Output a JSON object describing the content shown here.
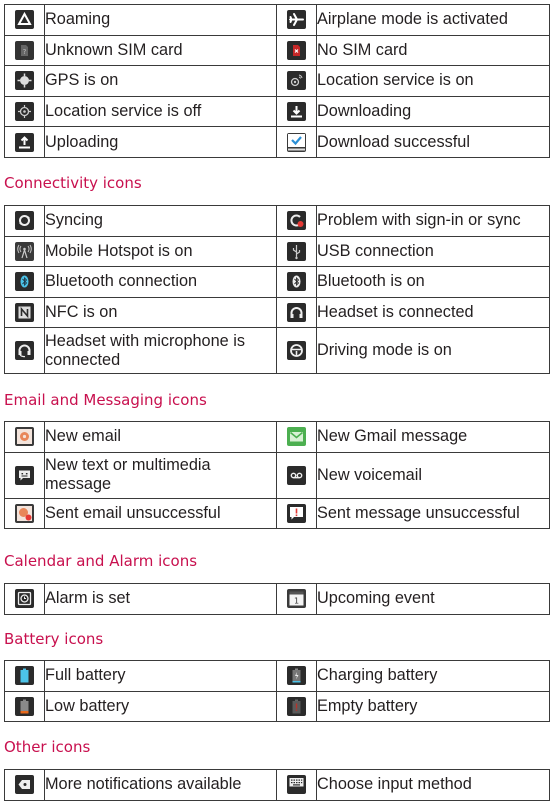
{
  "sections": {
    "status": {
      "rows": [
        {
          "left": {
            "icon": "roaming-icon",
            "label": "Roaming"
          },
          "right": {
            "icon": "airplane-icon",
            "label": "Airplane mode is activated"
          }
        },
        {
          "left": {
            "icon": "unknown-sim-icon",
            "label": "Unknown SIM card"
          },
          "right": {
            "icon": "no-sim-icon",
            "label": "No SIM card"
          }
        },
        {
          "left": {
            "icon": "gps-on-icon",
            "label": "GPS is on"
          },
          "right": {
            "icon": "location-on-icon",
            "label": "Location service is on"
          }
        },
        {
          "left": {
            "icon": "location-off-icon",
            "label": "Location service is off"
          },
          "right": {
            "icon": "download-icon",
            "label": "Downloading"
          }
        },
        {
          "left": {
            "icon": "upload-icon",
            "label": "Uploading"
          },
          "right": {
            "icon": "download-success-icon",
            "label": "Download successful"
          }
        }
      ]
    },
    "connectivity": {
      "title": "Connectivity icons",
      "rows": [
        {
          "left": {
            "icon": "sync-icon",
            "label": "Syncing"
          },
          "right": {
            "icon": "sync-problem-icon",
            "label": "Problem with sign-in or sync"
          }
        },
        {
          "left": {
            "icon": "hotspot-icon",
            "label": "Mobile Hotspot is on"
          },
          "right": {
            "icon": "usb-icon",
            "label": "USB connection"
          }
        },
        {
          "left": {
            "icon": "bluetooth-connected-icon",
            "label": "Bluetooth connection"
          },
          "right": {
            "icon": "bluetooth-on-icon",
            "label": "Bluetooth is on"
          }
        },
        {
          "left": {
            "icon": "nfc-icon",
            "label": "NFC is on"
          },
          "right": {
            "icon": "headset-icon",
            "label": "Headset is connected"
          }
        },
        {
          "left": {
            "icon": "headset-mic-icon",
            "label": "Headset with microphone is connected"
          },
          "right": {
            "icon": "driving-mode-icon",
            "label": "Driving mode is on"
          }
        }
      ]
    },
    "email": {
      "title": "Email and Messaging icons",
      "rows": [
        {
          "left": {
            "icon": "new-email-icon",
            "label": "New email"
          },
          "right": {
            "icon": "gmail-icon",
            "label": "New Gmail message"
          }
        },
        {
          "left": {
            "icon": "new-message-icon",
            "label": "New text or multimedia message"
          },
          "right": {
            "icon": "voicemail-icon",
            "label": "New voicemail"
          }
        },
        {
          "left": {
            "icon": "email-failed-icon",
            "label": "Sent email unsuccessful"
          },
          "right": {
            "icon": "message-failed-icon",
            "label": "Sent message unsuccessful"
          }
        }
      ]
    },
    "calendar": {
      "title": "Calendar and Alarm icons",
      "rows": [
        {
          "left": {
            "icon": "alarm-icon",
            "label": "Alarm is set"
          },
          "right": {
            "icon": "calendar-icon",
            "label": "Upcoming event"
          }
        }
      ]
    },
    "battery": {
      "title": "Battery icons",
      "rows": [
        {
          "left": {
            "icon": "battery-full-icon",
            "label": "Full battery"
          },
          "right": {
            "icon": "battery-charging-icon",
            "label": "Charging battery"
          }
        },
        {
          "left": {
            "icon": "battery-low-icon",
            "label": "Low battery"
          },
          "right": {
            "icon": "battery-empty-icon",
            "label": "Empty battery"
          }
        }
      ]
    },
    "other": {
      "title": "Other icons",
      "rows": [
        {
          "left": {
            "icon": "more-notifications-icon",
            "label": "More notifications available"
          },
          "right": {
            "icon": "keyboard-icon",
            "label": "Choose input method"
          }
        }
      ]
    }
  },
  "colors": {
    "heading": "#c8104e",
    "icon_bg": "#2b2b2b",
    "border": "#3a3a3a",
    "battery_blue": "#4cc3e8",
    "battery_low": "#e86a1c",
    "battery_empty": "#b8322a",
    "gmail_green": "#4caf50",
    "email_orange": "#e8875a",
    "alert_red": "#e53935"
  }
}
